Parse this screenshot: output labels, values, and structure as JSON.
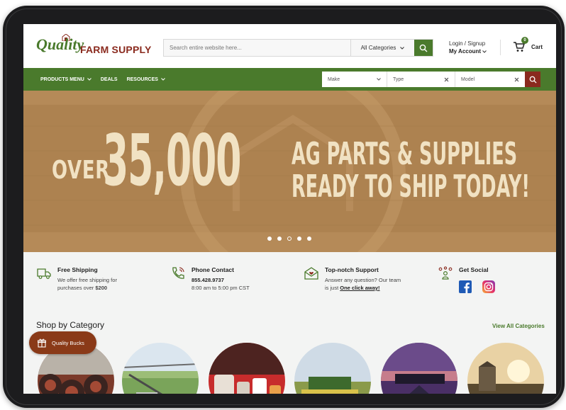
{
  "brand": {
    "logo_script": "Quality",
    "logo_block": "FARM SUPPLY",
    "green": "#4a7a2c",
    "red": "#8a2a1e"
  },
  "search": {
    "placeholder": "Search entire website here...",
    "category": "All Categories"
  },
  "account": {
    "login": "Login / Signup",
    "my_account": "My Account"
  },
  "cart": {
    "label": "Cart",
    "count": "0"
  },
  "nav": {
    "items": [
      "PRODUCTS MENU",
      "DEALS",
      "RESOURCES"
    ]
  },
  "finder": {
    "make": "Make",
    "type": "Type",
    "model": "Model"
  },
  "hero": {
    "over": "OVER",
    "number": "35,000",
    "line1": "AG PARTS & SUPPLIES",
    "line2": "READY TO SHIP TODAY!",
    "slides": 5,
    "active_slide": 3
  },
  "features": {
    "shipping": {
      "title": "Free Shipping",
      "line1": "We offer free shipping for",
      "line2_pre": "purchases over ",
      "line2_amount": "$200"
    },
    "phone": {
      "title": "Phone Contact",
      "number": "855.428.9737",
      "hours": "8:00 am to 5:00 pm CST"
    },
    "support": {
      "title": "Top-notch Support",
      "line1": "Answer any question? Our team",
      "line2_pre": "is just ",
      "line2_link": "One click away!"
    },
    "social": {
      "title": "Get Social"
    }
  },
  "categories": {
    "title": "Shop by Category",
    "view_all": "View All Categories"
  },
  "quality_bucks": {
    "label": "Quality Bucks"
  }
}
